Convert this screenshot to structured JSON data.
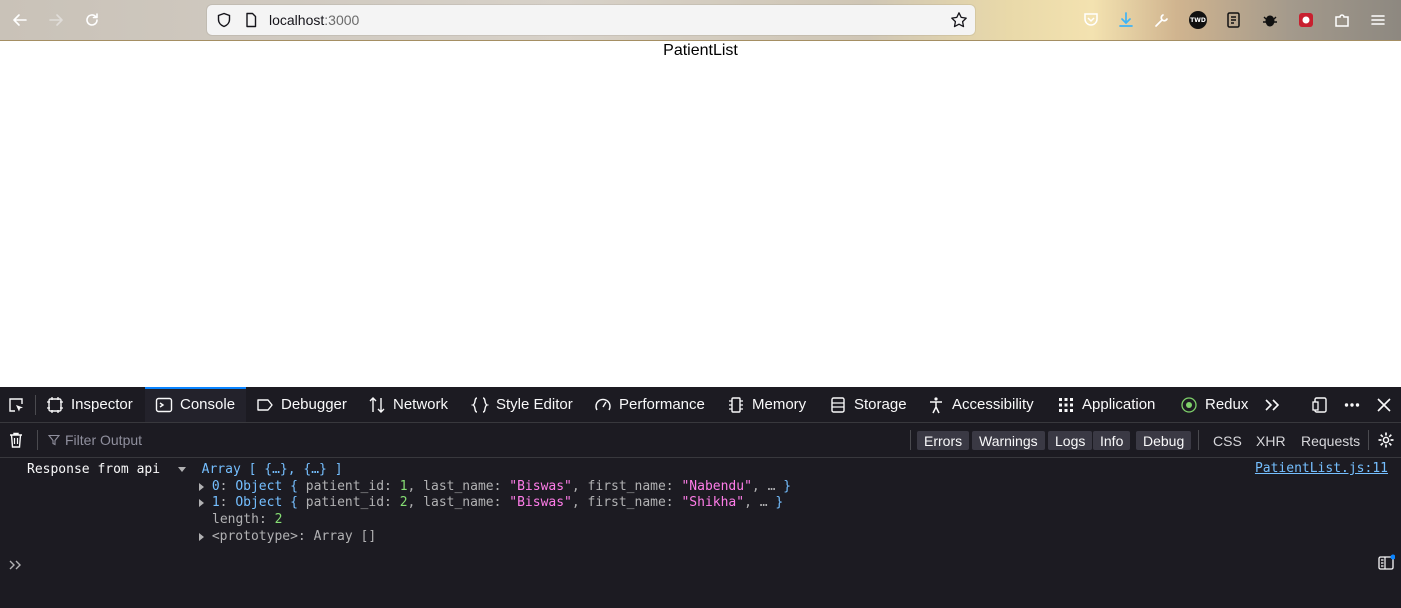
{
  "browser": {
    "url_host": "localhost",
    "url_port": ":3000",
    "ext_badge": "TWD"
  },
  "page": {
    "heading": "PatientList"
  },
  "devtools": {
    "tabs": [
      {
        "label": "Inspector",
        "icon": "inspector-icon"
      },
      {
        "label": "Console",
        "icon": "console-icon"
      },
      {
        "label": "Debugger",
        "icon": "debugger-icon"
      },
      {
        "label": "Network",
        "icon": "network-icon"
      },
      {
        "label": "Style Editor",
        "icon": "style-editor-icon"
      },
      {
        "label": "Performance",
        "icon": "performance-icon"
      },
      {
        "label": "Memory",
        "icon": "memory-icon"
      },
      {
        "label": "Storage",
        "icon": "storage-icon"
      },
      {
        "label": "Accessibility",
        "icon": "accessibility-icon"
      },
      {
        "label": "Application",
        "icon": "application-icon"
      },
      {
        "label": "Redux",
        "icon": "redux-icon"
      }
    ],
    "active_tab": "Console",
    "filter_placeholder": "Filter Output",
    "levels": [
      "Errors",
      "Warnings",
      "Logs",
      "Info",
      "Debug"
    ],
    "request_filters": [
      "CSS",
      "XHR",
      "Requests"
    ],
    "console": {
      "message_label": "Response from api",
      "array_summary": "Array [ {…}, {…} ]",
      "source": "PatientList.js:11",
      "items": [
        {
          "index": "0",
          "patient_id": "1",
          "last_name": "\"Biswas\"",
          "first_name": "\"Nabendu\""
        },
        {
          "index": "1",
          "patient_id": "2",
          "last_name": "\"Biswas\"",
          "first_name": "\"Shikha\""
        }
      ],
      "length_key": "length",
      "length_value": "2",
      "prototype_label": "<prototype>: Array []"
    }
  }
}
